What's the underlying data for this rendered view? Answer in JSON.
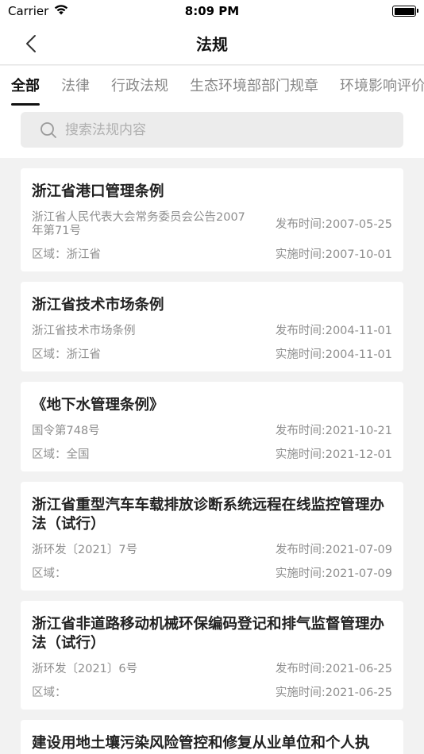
{
  "status_bar": {
    "carrier": "Carrier",
    "time": "8:09 PM"
  },
  "nav": {
    "title": "法规"
  },
  "tabs": [
    {
      "label": "全部",
      "active": true
    },
    {
      "label": "法律",
      "active": false
    },
    {
      "label": "行政法规",
      "active": false
    },
    {
      "label": "生态环境部部门规章",
      "active": false
    },
    {
      "label": "环境影响评价",
      "active": false
    }
  ],
  "search": {
    "placeholder": "搜索法规内容"
  },
  "items": [
    {
      "title": "浙江省港口管理条例",
      "source": "浙江省人民代表大会常务委员会公告2007年第71号",
      "publish": "发布时间:2007-05-25",
      "region": "区域：浙江省",
      "effective": "实施时间:2007-10-01"
    },
    {
      "title": "浙江省技术市场条例",
      "source": "浙江省技术市场条例",
      "publish": "发布时间:2004-11-01",
      "region": "区域：浙江省",
      "effective": "实施时间:2004-11-01"
    },
    {
      "title": "《地下水管理条例》",
      "source": "国令第748号",
      "publish": "发布时间:2021-10-21",
      "region": "区域：全国",
      "effective": "实施时间:2021-12-01"
    },
    {
      "title": "浙江省重型汽车车载排放诊断系统远程在线监控管理办法（试行）",
      "source": "浙环发〔2021〕7号",
      "publish": "发布时间:2021-07-09",
      "region": "区域：",
      "effective": "实施时间:2021-07-09"
    },
    {
      "title": "浙江省非道路移动机械环保编码登记和排气监督管理办法（试行）",
      "source": "浙环发〔2021〕6号",
      "publish": "发布时间:2021-06-25",
      "region": "区域：",
      "effective": "实施时间:2021-06-25"
    },
    {
      "title": "建设用地土壤污染风险管控和修复从业单位和个人执",
      "source": "",
      "publish": "",
      "region": "",
      "effective": ""
    }
  ]
}
